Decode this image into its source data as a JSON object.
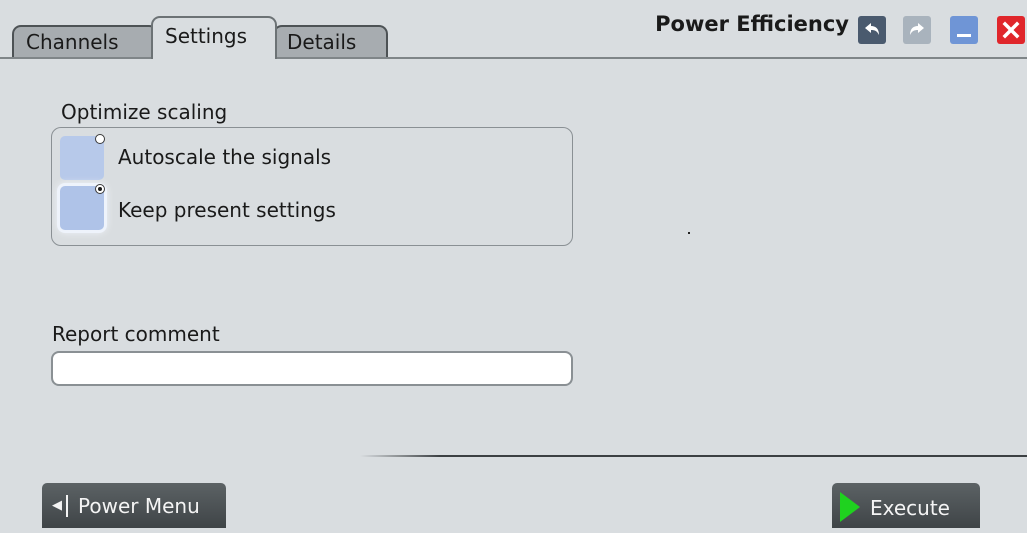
{
  "tabs": [
    {
      "label": "Channels",
      "active": false
    },
    {
      "label": "Settings",
      "active": true
    },
    {
      "label": "Details",
      "active": false
    }
  ],
  "window": {
    "title": "Power Efficiency",
    "buttons": [
      {
        "name": "undo",
        "icon": "undo-arrow-icon",
        "color": "#4a5a6e"
      },
      {
        "name": "redo",
        "icon": "redo-arrow-icon",
        "color": "#a9b3bd"
      },
      {
        "name": "minimize",
        "icon": "minimize-icon",
        "color": "#6f95d6"
      },
      {
        "name": "close",
        "icon": "close-icon",
        "color": "#e0262b"
      }
    ]
  },
  "optimize_scaling": {
    "label": "Optimize scaling",
    "options": [
      {
        "label": "Autoscale the signals",
        "selected": false
      },
      {
        "label": "Keep present settings",
        "selected": true
      }
    ]
  },
  "report_comment": {
    "label": "Report comment",
    "value": "",
    "placeholder": ""
  },
  "footer": {
    "menu_button": "Power Menu",
    "execute_button": "Execute",
    "execute_icon_color": "#1fd21f"
  }
}
